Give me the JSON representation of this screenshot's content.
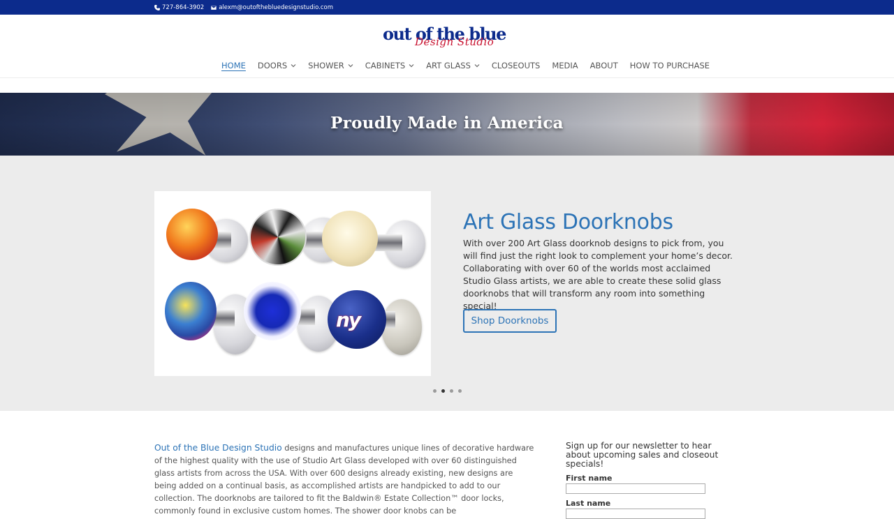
{
  "topbar": {
    "phone": "727-864-3902",
    "email": "alexm@outofthebluedesignstudio.com"
  },
  "logo": {
    "line1": "out of the blue",
    "line2": "Design Studio"
  },
  "nav": {
    "items": [
      {
        "label": "HOME",
        "active": true,
        "dropdown": false
      },
      {
        "label": "DOORS",
        "dropdown": true
      },
      {
        "label": "SHOWER",
        "dropdown": true
      },
      {
        "label": "CABINETS",
        "dropdown": true
      },
      {
        "label": "ART GLASS",
        "dropdown": true
      },
      {
        "label": "CLOSEOUTS",
        "dropdown": false
      },
      {
        "label": "MEDIA",
        "dropdown": false
      },
      {
        "label": "ABOUT",
        "dropdown": false
      },
      {
        "label": "HOW TO PURCHASE",
        "dropdown": false
      }
    ]
  },
  "banner": {
    "title": "Proudly Made in America"
  },
  "slider": {
    "title": "Art Glass Doorknobs",
    "description": "With over 200 Art Glass doorknob designs to pick from, you will find just the right look to complement your home’s decor. Collaborating with over 60 of the worlds most acclaimed Studio Glass artists, we are able to create these solid glass doorknobs that will transform any room into something special!",
    "button_label": "Shop Doorknobs",
    "dots_total": 4,
    "dots_active_index": 1
  },
  "intro": {
    "brand": "Out of the Blue Design Studio",
    "text": " designs and manufactures unique lines of decorative hardware of the highest quality with the use of Studio Art Glass developed with over 60 distinguished glass artists from across the USA. With over 600 designs already existing, new designs are being added on a continual basis, as accomplished artists are handpicked to add to our collection. The doorknobs are tailored to fit the Baldwin® Estate Collection™ door locks, commonly found in exclusive custom homes. The shower door knobs can be"
  },
  "newsletter": {
    "lead": "Sign up for our newsletter to hear about upcoming sales and closeout specials!",
    "first_name_label": "First name",
    "last_name_label": "Last name"
  },
  "colors": {
    "topbar_bg": "#0c2b8c",
    "accent": "#2c73b6",
    "logo_red": "#c8102e"
  }
}
